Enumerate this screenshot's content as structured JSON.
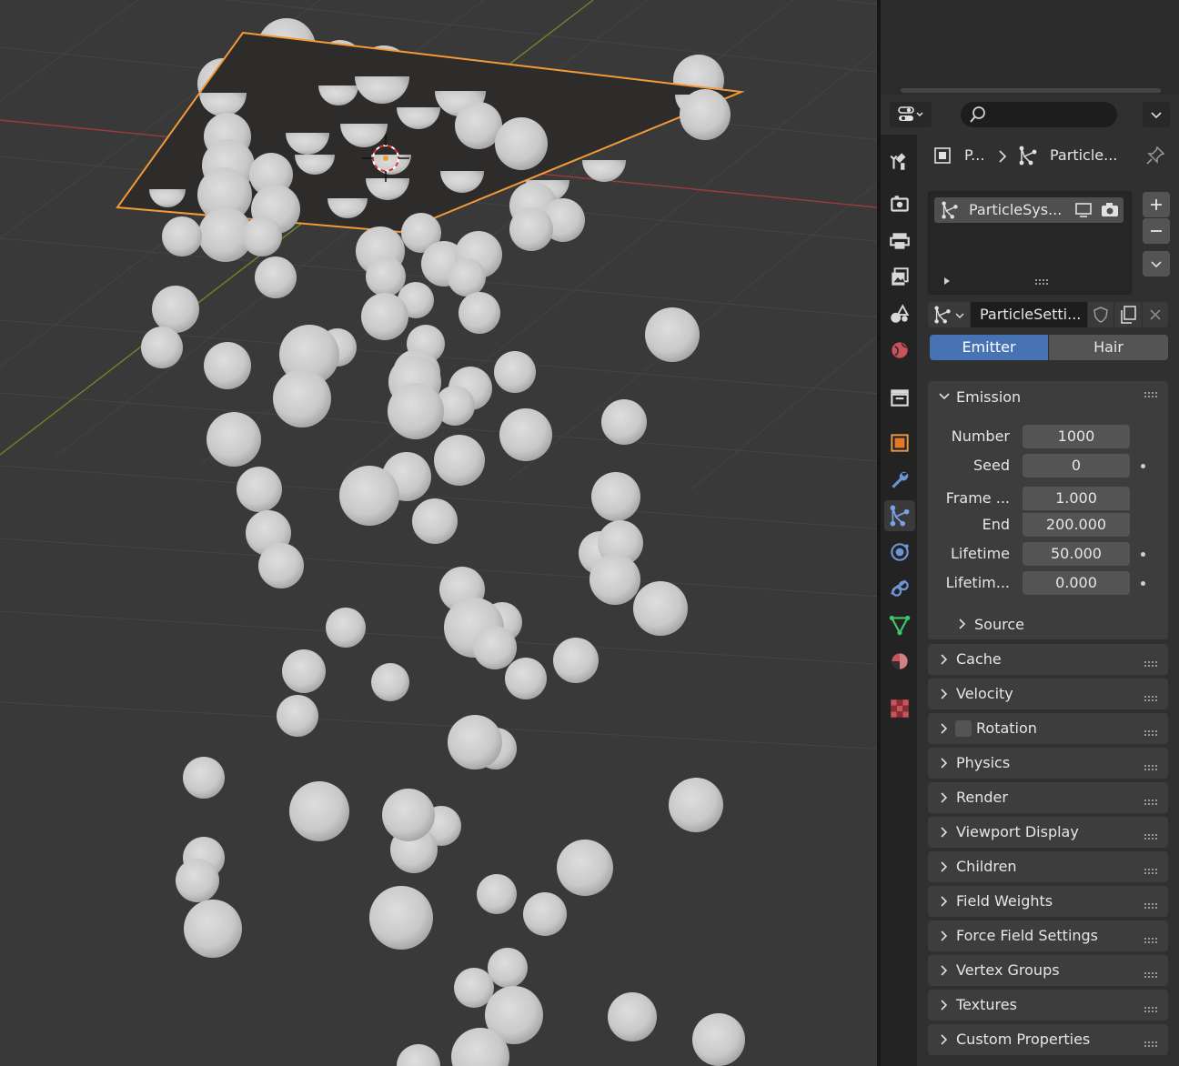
{
  "properties_header": {
    "search": {
      "placeholder": "",
      "value": ""
    },
    "breadcrumb": {
      "object": "P...",
      "item": "Particle..."
    }
  },
  "particle_system_list": {
    "items": [
      {
        "label": "ParticleSys...",
        "selected": true
      }
    ]
  },
  "particle_settings": {
    "datablock": "ParticleSetti...",
    "type_options": [
      {
        "label": "Emitter",
        "active": true
      },
      {
        "label": "Hair",
        "active": false
      }
    ]
  },
  "emission": {
    "title": "Emission",
    "fields": [
      {
        "label": "Number",
        "value": "1000"
      },
      {
        "label": "Seed",
        "value": "0"
      },
      {
        "label": "Frame ...",
        "value": "1.000"
      },
      {
        "label": "End",
        "value": "200.000"
      },
      {
        "label": "Lifetime",
        "value": "50.000"
      },
      {
        "label": "Lifetim...",
        "value": "0.000"
      }
    ],
    "source_label": "Source"
  },
  "sections": [
    {
      "title": "Cache"
    },
    {
      "title": "Velocity"
    },
    {
      "title": "Rotation",
      "checkbox": true
    },
    {
      "title": "Physics"
    },
    {
      "title": "Render"
    },
    {
      "title": "Viewport Display"
    },
    {
      "title": "Children"
    },
    {
      "title": "Field Weights"
    },
    {
      "title": "Force Field Settings"
    },
    {
      "title": "Vertex Groups"
    },
    {
      "title": "Textures"
    },
    {
      "title": "Custom Properties"
    }
  ],
  "property_tabs": [
    "tool-icon",
    "render-icon",
    "output-icon",
    "view-layer-icon",
    "scene-icon",
    "world-icon",
    "collection-icon",
    "object-icon",
    "modifier-icon",
    "particles-icon",
    "physics-icon",
    "constraints-icon",
    "data-icon",
    "material-icon",
    "texture-icon"
  ],
  "colors": {
    "accent_blue": "#4772b3",
    "selection_orange": "#f29a38",
    "x_axis": "#9b3a3f",
    "y_axis": "#6a8a25"
  }
}
